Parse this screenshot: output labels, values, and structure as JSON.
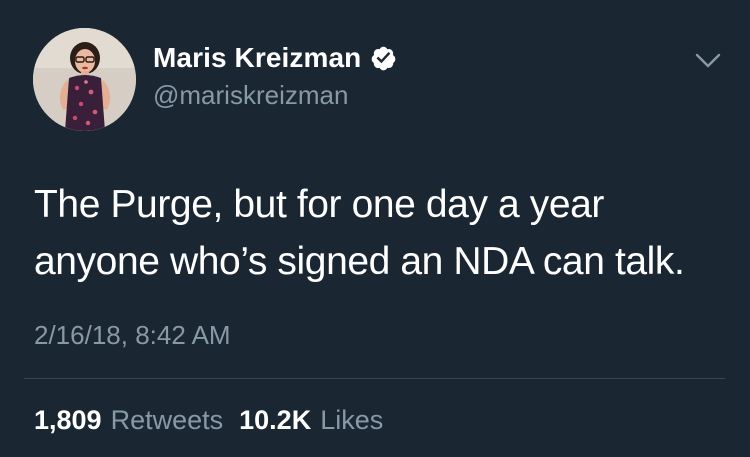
{
  "author": {
    "display_name": "Maris Kreizman",
    "handle": "@mariskreizman",
    "verified": true,
    "avatar_icon": "profile-photo"
  },
  "tweet": {
    "lines": [
      "The Purge, but for one day a year",
      "anyone who’s signed an NDA can talk."
    ],
    "timestamp": "2/16/18, 8:42 AM"
  },
  "stats": {
    "retweets_count": "1,809",
    "retweets_label": "Retweets",
    "likes_count": "10.2K",
    "likes_label": "Likes"
  },
  "icons": {
    "verified": "verified-badge-icon",
    "menu": "chevron-down-icon"
  },
  "colors": {
    "background": "#1b2633",
    "primary_text": "#ffffff",
    "secondary_text": "#8899a6",
    "divider": "#3a4652"
  }
}
